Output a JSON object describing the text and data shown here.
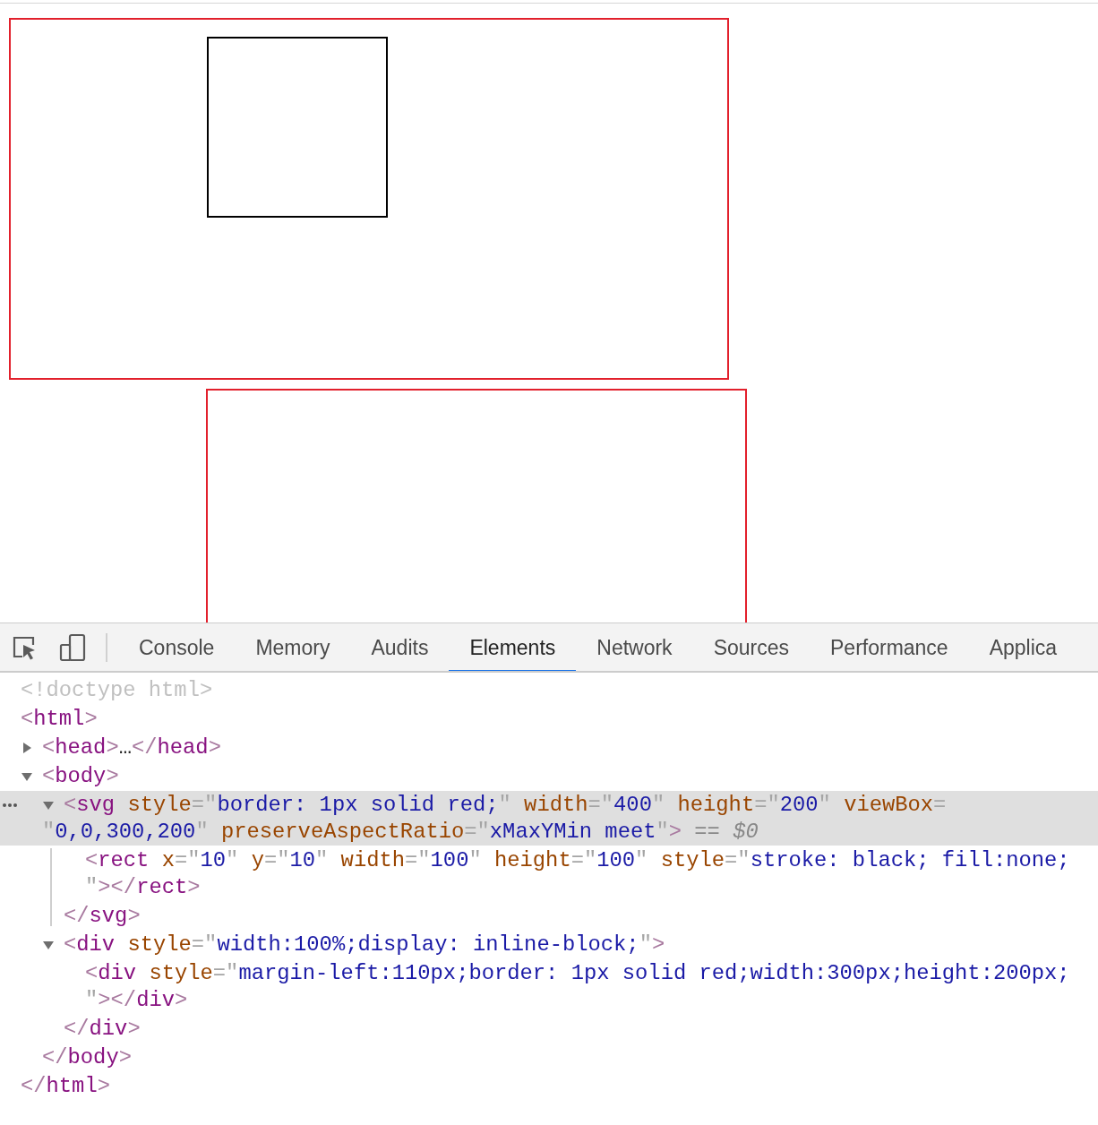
{
  "devtools": {
    "tabs": [
      {
        "label": "Console",
        "selected": false
      },
      {
        "label": "Memory",
        "selected": false
      },
      {
        "label": "Audits",
        "selected": false
      },
      {
        "label": "Elements",
        "selected": true
      },
      {
        "label": "Network",
        "selected": false
      },
      {
        "label": "Sources",
        "selected": false
      },
      {
        "label": "Performance",
        "selected": false
      },
      {
        "label": "Applica",
        "selected": false
      }
    ],
    "dom_tree": [
      {
        "selected": false,
        "lines": [
          [
            {
              "kind": "doctype",
              "text": "<!doctype html>"
            }
          ]
        ]
      },
      {
        "selected": false,
        "lines": [
          [
            {
              "kind": "bracket",
              "text": "<"
            },
            {
              "kind": "tag",
              "text": "html"
            },
            {
              "kind": "bracket",
              "text": ">"
            }
          ]
        ],
        "close": [
          {
            "kind": "bracket",
            "text": "</"
          },
          {
            "kind": "tag",
            "text": "html"
          },
          {
            "kind": "bracket",
            "text": ">"
          }
        ],
        "children": [
          {
            "selected": false,
            "expanded": false,
            "lines": [
              [
                {
                  "kind": "bracket",
                  "text": "<"
                },
                {
                  "kind": "tag",
                  "text": "head"
                },
                {
                  "kind": "bracket",
                  "text": ">"
                },
                {
                  "kind": "ellipsis",
                  "text": "…"
                },
                {
                  "kind": "bracket",
                  "text": "</"
                },
                {
                  "kind": "tag",
                  "text": "head"
                },
                {
                  "kind": "bracket",
                  "text": ">"
                }
              ]
            ]
          },
          {
            "selected": false,
            "expanded": true,
            "lines": [
              [
                {
                  "kind": "bracket",
                  "text": "<"
                },
                {
                  "kind": "tag",
                  "text": "body"
                },
                {
                  "kind": "bracket",
                  "text": ">"
                }
              ]
            ],
            "close": [
              {
                "kind": "bracket",
                "text": "</"
              },
              {
                "kind": "tag",
                "text": "body"
              },
              {
                "kind": "bracket",
                "text": ">"
              }
            ],
            "children": [
              {
                "selected": true,
                "expanded": true,
                "lines": [
                  [
                    {
                      "kind": "bracket",
                      "text": "<"
                    },
                    {
                      "kind": "tag",
                      "text": "svg"
                    },
                    {
                      "kind": "attr",
                      "text": " style"
                    },
                    {
                      "kind": "quote",
                      "text": "=\""
                    },
                    {
                      "kind": "value",
                      "text": "border: 1px solid red;"
                    },
                    {
                      "kind": "quote",
                      "text": "\""
                    },
                    {
                      "kind": "attr",
                      "text": " width"
                    },
                    {
                      "kind": "quote",
                      "text": "=\""
                    },
                    {
                      "kind": "value",
                      "text": "400"
                    },
                    {
                      "kind": "quote",
                      "text": "\""
                    },
                    {
                      "kind": "attr",
                      "text": " height"
                    },
                    {
                      "kind": "quote",
                      "text": "=\""
                    },
                    {
                      "kind": "value",
                      "text": "200"
                    },
                    {
                      "kind": "quote",
                      "text": "\""
                    },
                    {
                      "kind": "attr",
                      "text": " viewBox"
                    },
                    {
                      "kind": "quote",
                      "text": "="
                    }
                  ],
                  [
                    {
                      "kind": "quote",
                      "text": "\""
                    },
                    {
                      "kind": "value",
                      "text": "0,0,300,200"
                    },
                    {
                      "kind": "quote",
                      "text": "\""
                    },
                    {
                      "kind": "attr",
                      "text": " preserveAspectRatio"
                    },
                    {
                      "kind": "quote",
                      "text": "=\""
                    },
                    {
                      "kind": "value",
                      "text": "xMaxYMin meet"
                    },
                    {
                      "kind": "quote",
                      "text": "\""
                    },
                    {
                      "kind": "bracket",
                      "text": ">"
                    },
                    {
                      "kind": "marker",
                      "text": " == "
                    },
                    {
                      "kind": "ref",
                      "text": "$0"
                    }
                  ]
                ],
                "close": [
                  {
                    "kind": "bracket",
                    "text": "</"
                  },
                  {
                    "kind": "tag",
                    "text": "svg"
                  },
                  {
                    "kind": "bracket",
                    "text": ">"
                  }
                ],
                "children": [
                  {
                    "selected": false,
                    "lines": [
                      [
                        {
                          "kind": "bracket",
                          "text": "<"
                        },
                        {
                          "kind": "tag",
                          "text": "rect"
                        },
                        {
                          "kind": "attr",
                          "text": " x"
                        },
                        {
                          "kind": "quote",
                          "text": "=\""
                        },
                        {
                          "kind": "value",
                          "text": "10"
                        },
                        {
                          "kind": "quote",
                          "text": "\""
                        },
                        {
                          "kind": "attr",
                          "text": " y"
                        },
                        {
                          "kind": "quote",
                          "text": "=\""
                        },
                        {
                          "kind": "value",
                          "text": "10"
                        },
                        {
                          "kind": "quote",
                          "text": "\""
                        },
                        {
                          "kind": "attr",
                          "text": " width"
                        },
                        {
                          "kind": "quote",
                          "text": "=\""
                        },
                        {
                          "kind": "value",
                          "text": "100"
                        },
                        {
                          "kind": "quote",
                          "text": "\""
                        },
                        {
                          "kind": "attr",
                          "text": " height"
                        },
                        {
                          "kind": "quote",
                          "text": "=\""
                        },
                        {
                          "kind": "value",
                          "text": "100"
                        },
                        {
                          "kind": "quote",
                          "text": "\""
                        },
                        {
                          "kind": "attr",
                          "text": " style"
                        },
                        {
                          "kind": "quote",
                          "text": "=\""
                        },
                        {
                          "kind": "value",
                          "text": "stroke: black; fill:none;"
                        }
                      ],
                      [
                        {
                          "kind": "quote",
                          "text": "\""
                        },
                        {
                          "kind": "bracket",
                          "text": "></"
                        },
                        {
                          "kind": "tag",
                          "text": "rect"
                        },
                        {
                          "kind": "bracket",
                          "text": ">"
                        }
                      ]
                    ]
                  }
                ]
              },
              {
                "selected": false,
                "expanded": true,
                "lines": [
                  [
                    {
                      "kind": "bracket",
                      "text": "<"
                    },
                    {
                      "kind": "tag",
                      "text": "div"
                    },
                    {
                      "kind": "attr",
                      "text": " style"
                    },
                    {
                      "kind": "quote",
                      "text": "=\""
                    },
                    {
                      "kind": "value",
                      "text": "width:100%;display: inline-block;"
                    },
                    {
                      "kind": "quote",
                      "text": "\""
                    },
                    {
                      "kind": "bracket",
                      "text": ">"
                    }
                  ]
                ],
                "close": [
                  {
                    "kind": "bracket",
                    "text": "</"
                  },
                  {
                    "kind": "tag",
                    "text": "div"
                  },
                  {
                    "kind": "bracket",
                    "text": ">"
                  }
                ],
                "children": [
                  {
                    "selected": false,
                    "lines": [
                      [
                        {
                          "kind": "bracket",
                          "text": "<"
                        },
                        {
                          "kind": "tag",
                          "text": "div"
                        },
                        {
                          "kind": "attr",
                          "text": " style"
                        },
                        {
                          "kind": "quote",
                          "text": "=\""
                        },
                        {
                          "kind": "value",
                          "text": "margin-left:110px;border: 1px solid red;width:300px;height:200px;"
                        }
                      ],
                      [
                        {
                          "kind": "quote",
                          "text": "\""
                        },
                        {
                          "kind": "bracket",
                          "text": "></"
                        },
                        {
                          "kind": "tag",
                          "text": "div"
                        },
                        {
                          "kind": "bracket",
                          "text": ">"
                        }
                      ]
                    ]
                  }
                ]
              }
            ]
          }
        ]
      }
    ]
  }
}
